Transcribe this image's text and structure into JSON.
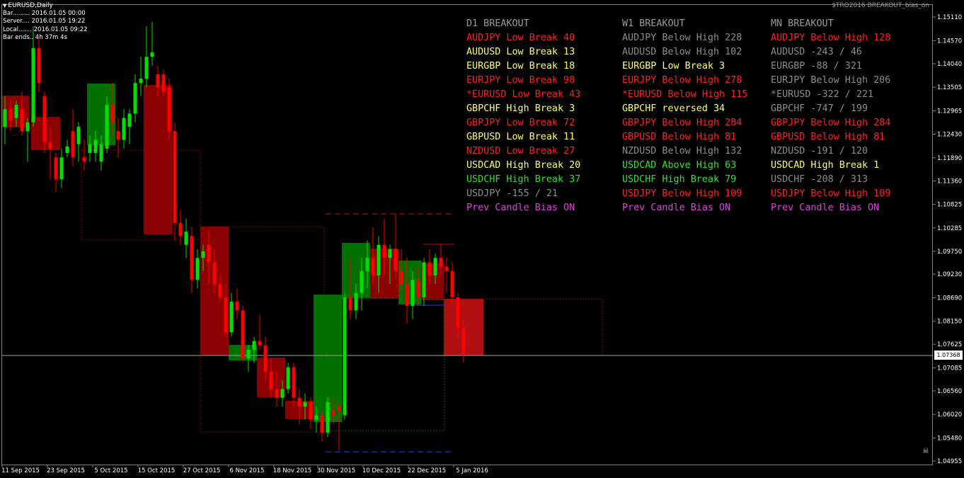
{
  "window": {
    "title": "EURUSD,Daily",
    "indicator_name": "$TRO2016 BREAKOUT_bias_on"
  },
  "info_panel": [
    "Bar......... 2016.01.05 00:00",
    "Server.... 2016.01.05 19:22",
    "Local....... 2016.01.05 09:22",
    "Bar ends.. 4h 37m 4s"
  ],
  "colors": {
    "red": "#ff2020",
    "yellow": "#ffff66",
    "gray": "#8c8c8c",
    "green": "#33e033",
    "magenta": "#e040e0",
    "header": "#9a9a9a"
  },
  "columns": [
    {
      "header": "D1 BREAKOUT",
      "rows": [
        {
          "text": "AUDJPY Low Break 40",
          "color": "red"
        },
        {
          "text": "AUDUSD Low Break 13",
          "color": "yellow"
        },
        {
          "text": "EURGBP Low Break 18",
          "color": "yellow"
        },
        {
          "text": "EURJPY Low Break 98",
          "color": "red"
        },
        {
          "text": "*EURUSD Low Break 43",
          "color": "red"
        },
        {
          "text": "GBPCHF High Break 3",
          "color": "yellow"
        },
        {
          "text": "GBPJPY Low Break 72",
          "color": "red"
        },
        {
          "text": "GBPUSD Low Break 11",
          "color": "yellow"
        },
        {
          "text": "NZDUSD Low Break 27",
          "color": "red"
        },
        {
          "text": "USDCAD High Break 20",
          "color": "yellow"
        },
        {
          "text": "USDCHF High Break 37",
          "color": "green"
        },
        {
          "text": "USDJPY -155 / 21",
          "color": "gray"
        },
        {
          "text": "Prev Candle Bias ON",
          "color": "magenta"
        }
      ]
    },
    {
      "header": "W1 BREAKOUT",
      "rows": [
        {
          "text": "AUDJPY Below High 228",
          "color": "gray"
        },
        {
          "text": "AUDUSD Below High 102",
          "color": "gray"
        },
        {
          "text": "EURGBP Low Break 3",
          "color": "yellow"
        },
        {
          "text": "EURJPY Below High 278",
          "color": "red"
        },
        {
          "text": "*EURUSD Below High 115",
          "color": "red"
        },
        {
          "text": "GBPCHF reversed 34",
          "color": "yellow"
        },
        {
          "text": "GBPJPY Below High 284",
          "color": "red"
        },
        {
          "text": "GBPUSD Below High 81",
          "color": "red"
        },
        {
          "text": "NZDUSD Below High 132",
          "color": "gray"
        },
        {
          "text": "USDCAD Above High 63",
          "color": "green"
        },
        {
          "text": "USDCHF High Break 79",
          "color": "green"
        },
        {
          "text": "USDJPY Below High 109",
          "color": "red"
        },
        {
          "text": "Prev Candle Bias ON",
          "color": "magenta"
        }
      ]
    },
    {
      "header": "MN BREAKOUT",
      "rows": [
        {
          "text": "AUDJPY Below High 128",
          "color": "red"
        },
        {
          "text": "AUDUSD -243 / 46",
          "color": "gray"
        },
        {
          "text": "EURGBP -88 / 321",
          "color": "gray"
        },
        {
          "text": "EURJPY Below High 206",
          "color": "gray"
        },
        {
          "text": "*EURUSD -322 / 221",
          "color": "gray"
        },
        {
          "text": "GBPCHF -747 / 199",
          "color": "gray"
        },
        {
          "text": "GBPJPY Below High 284",
          "color": "red"
        },
        {
          "text": "GBPUSD Below High 81",
          "color": "red"
        },
        {
          "text": "NZDUSD -191 / 120",
          "color": "gray"
        },
        {
          "text": "USDCAD High Break 1",
          "color": "yellow"
        },
        {
          "text": "USDCHF -208 / 313",
          "color": "gray"
        },
        {
          "text": "USDJPY Below High 109",
          "color": "red"
        },
        {
          "text": "Prev Candle Bias ON",
          "color": "magenta"
        }
      ]
    }
  ],
  "price_axis": {
    "labels": [
      "1.15110",
      "1.14570",
      "1.14040",
      "1.13505",
      "1.12965",
      "1.12430",
      "1.11890",
      "1.11360",
      "1.10825",
      "1.10285",
      "1.09750",
      "1.09230",
      "1.08690",
      "1.08150",
      "1.07625",
      "1.07085",
      "1.06560",
      "1.06020",
      "1.05480",
      "1.04955"
    ],
    "current_price": "1.07368"
  },
  "time_axis": {
    "labels": [
      "11 Sep 2015",
      "23 Sep 2015",
      "5 Oct 2015",
      "15 Oct 2015",
      "27 Oct 2015",
      "6 Nov 2015",
      "18 Nov 2015",
      "30 Nov 2015",
      "10 Dec 2015",
      "22 Dec 2015",
      "5 Jan 2016"
    ]
  },
  "chart_data": {
    "type": "candlestick",
    "symbol": "EURUSD",
    "timeframe": "Daily",
    "ylim": [
      1.04955,
      1.1511
    ],
    "candles": [
      {
        "o": 1.126,
        "h": 1.133,
        "l": 1.122,
        "c": 1.13
      },
      {
        "o": 1.13,
        "h": 1.132,
        "l": 1.125,
        "c": 1.1275
      },
      {
        "o": 1.128,
        "h": 1.132,
        "l": 1.126,
        "c": 1.131
      },
      {
        "o": 1.13,
        "h": 1.134,
        "l": 1.124,
        "c": 1.125
      },
      {
        "o": 1.125,
        "h": 1.128,
        "l": 1.118,
        "c": 1.127
      },
      {
        "o": 1.127,
        "h": 1.149,
        "l": 1.126,
        "c": 1.144
      },
      {
        "o": 1.144,
        "h": 1.146,
        "l": 1.134,
        "c": 1.136
      },
      {
        "o": 1.133,
        "h": 1.134,
        "l": 1.12,
        "c": 1.1225
      },
      {
        "o": 1.1225,
        "h": 1.126,
        "l": 1.114,
        "c": 1.121
      },
      {
        "o": 1.119,
        "h": 1.12,
        "l": 1.111,
        "c": 1.114
      },
      {
        "o": 1.114,
        "h": 1.121,
        "l": 1.112,
        "c": 1.119
      },
      {
        "o": 1.12,
        "h": 1.123,
        "l": 1.119,
        "c": 1.1215
      },
      {
        "o": 1.125,
        "h": 1.13,
        "l": 1.117,
        "c": 1.119
      },
      {
        "o": 1.122,
        "h": 1.127,
        "l": 1.118,
        "c": 1.126
      },
      {
        "o": 1.119,
        "h": 1.123,
        "l": 1.116,
        "c": 1.118
      },
      {
        "o": 1.12,
        "h": 1.124,
        "l": 1.118,
        "c": 1.122
      },
      {
        "o": 1.12,
        "h": 1.125,
        "l": 1.118,
        "c": 1.123
      },
      {
        "o": 1.118,
        "h": 1.124,
        "l": 1.116,
        "c": 1.122
      },
      {
        "o": 1.121,
        "h": 1.133,
        "l": 1.12,
        "c": 1.131
      },
      {
        "o": 1.131,
        "h": 1.136,
        "l": 1.124,
        "c": 1.127
      },
      {
        "o": 1.125,
        "h": 1.128,
        "l": 1.119,
        "c": 1.123
      },
      {
        "o": 1.123,
        "h": 1.13,
        "l": 1.121,
        "c": 1.128
      },
      {
        "o": 1.126,
        "h": 1.13,
        "l": 1.122,
        "c": 1.129
      },
      {
        "o": 1.129,
        "h": 1.138,
        "l": 1.127,
        "c": 1.136
      },
      {
        "o": 1.136,
        "h": 1.142,
        "l": 1.133,
        "c": 1.137
      },
      {
        "o": 1.137,
        "h": 1.149,
        "l": 1.135,
        "c": 1.142
      },
      {
        "o": 1.142,
        "h": 1.15,
        "l": 1.14,
        "c": 1.143
      },
      {
        "o": 1.138,
        "h": 1.14,
        "l": 1.133,
        "c": 1.135
      },
      {
        "o": 1.138,
        "h": 1.139,
        "l": 1.133,
        "c": 1.134
      },
      {
        "o": 1.135,
        "h": 1.137,
        "l": 1.123,
        "c": 1.125
      },
      {
        "o": 1.125,
        "h": 1.127,
        "l": 1.1,
        "c": 1.104
      },
      {
        "o": 1.104,
        "h": 1.107,
        "l": 1.099,
        "c": 1.101
      },
      {
        "o": 1.099,
        "h": 1.105,
        "l": 1.096,
        "c": 1.102
      },
      {
        "o": 1.101,
        "h": 1.103,
        "l": 1.088,
        "c": 1.091
      },
      {
        "o": 1.091,
        "h": 1.098,
        "l": 1.089,
        "c": 1.096
      },
      {
        "o": 1.096,
        "h": 1.099,
        "l": 1.093,
        "c": 1.0975
      },
      {
        "o": 1.099,
        "h": 1.102,
        "l": 1.09,
        "c": 1.095
      },
      {
        "o": 1.095,
        "h": 1.098,
        "l": 1.088,
        "c": 1.09
      },
      {
        "o": 1.09,
        "h": 1.092,
        "l": 1.086,
        "c": 1.087
      },
      {
        "o": 1.087,
        "h": 1.09,
        "l": 1.078,
        "c": 1.079
      },
      {
        "o": 1.079,
        "h": 1.088,
        "l": 1.078,
        "c": 1.086
      },
      {
        "o": 1.086,
        "h": 1.089,
        "l": 1.082,
        "c": 1.084
      },
      {
        "o": 1.084,
        "h": 1.085,
        "l": 1.072,
        "c": 1.073
      },
      {
        "o": 1.073,
        "h": 1.076,
        "l": 1.07,
        "c": 1.075
      },
      {
        "o": 1.075,
        "h": 1.078,
        "l": 1.072,
        "c": 1.077
      },
      {
        "o": 1.077,
        "h": 1.083,
        "l": 1.075,
        "c": 1.076
      },
      {
        "o": 1.076,
        "h": 1.078,
        "l": 1.068,
        "c": 1.07
      },
      {
        "o": 1.07,
        "h": 1.073,
        "l": 1.064,
        "c": 1.066
      },
      {
        "o": 1.066,
        "h": 1.07,
        "l": 1.062,
        "c": 1.064
      },
      {
        "o": 1.064,
        "h": 1.068,
        "l": 1.062,
        "c": 1.066
      },
      {
        "o": 1.066,
        "h": 1.072,
        "l": 1.065,
        "c": 1.071
      },
      {
        "o": 1.071,
        "h": 1.072,
        "l": 1.062,
        "c": 1.064
      },
      {
        "o": 1.064,
        "h": 1.066,
        "l": 1.058,
        "c": 1.062
      },
      {
        "o": 1.062,
        "h": 1.065,
        "l": 1.059,
        "c": 1.063
      },
      {
        "o": 1.063,
        "h": 1.064,
        "l": 1.057,
        "c": 1.059
      },
      {
        "o": 1.059,
        "h": 1.062,
        "l": 1.056,
        "c": 1.06
      },
      {
        "o": 1.06,
        "h": 1.061,
        "l": 1.054,
        "c": 1.056
      },
      {
        "o": 1.056,
        "h": 1.064,
        "l": 1.055,
        "c": 1.063
      },
      {
        "o": 1.061,
        "h": 1.064,
        "l": 1.058,
        "c": 1.06
      },
      {
        "o": 1.062,
        "h": 1.063,
        "l": 1.052,
        "c": 1.061
      },
      {
        "o": 1.06,
        "h": 1.088,
        "l": 1.059,
        "c": 1.087
      },
      {
        "o": 1.087,
        "h": 1.096,
        "l": 1.082,
        "c": 1.084
      },
      {
        "o": 1.084,
        "h": 1.09,
        "l": 1.082,
        "c": 1.088
      },
      {
        "o": 1.088,
        "h": 1.096,
        "l": 1.084,
        "c": 1.093
      },
      {
        "o": 1.093,
        "h": 1.1,
        "l": 1.089,
        "c": 1.096
      },
      {
        "o": 1.096,
        "h": 1.103,
        "l": 1.09,
        "c": 1.092
      },
      {
        "o": 1.092,
        "h": 1.101,
        "l": 1.088,
        "c": 1.099
      },
      {
        "o": 1.099,
        "h": 1.105,
        "l": 1.092,
        "c": 1.096
      },
      {
        "o": 1.096,
        "h": 1.099,
        "l": 1.09,
        "c": 1.098
      },
      {
        "o": 1.098,
        "h": 1.106,
        "l": 1.091,
        "c": 1.093
      },
      {
        "o": 1.093,
        "h": 1.098,
        "l": 1.088,
        "c": 1.09
      },
      {
        "o": 1.09,
        "h": 1.096,
        "l": 1.081,
        "c": 1.085
      },
      {
        "o": 1.085,
        "h": 1.093,
        "l": 1.082,
        "c": 1.091
      },
      {
        "o": 1.091,
        "h": 1.094,
        "l": 1.085,
        "c": 1.087
      },
      {
        "o": 1.087,
        "h": 1.096,
        "l": 1.085,
        "c": 1.095
      },
      {
        "o": 1.095,
        "h": 1.098,
        "l": 1.09,
        "c": 1.092
      },
      {
        "o": 1.092,
        "h": 1.097,
        "l": 1.09,
        "c": 1.096
      },
      {
        "o": 1.096,
        "h": 1.099,
        "l": 1.092,
        "c": 1.094
      },
      {
        "o": 1.094,
        "h": 1.096,
        "l": 1.088,
        "c": 1.093
      },
      {
        "o": 1.093,
        "h": 1.095,
        "l": 1.086,
        "c": 1.087
      },
      {
        "o": 1.087,
        "h": 1.088,
        "l": 1.078,
        "c": 1.08
      },
      {
        "o": 1.08,
        "h": 1.082,
        "l": 1.072,
        "c": 1.074
      }
    ]
  }
}
